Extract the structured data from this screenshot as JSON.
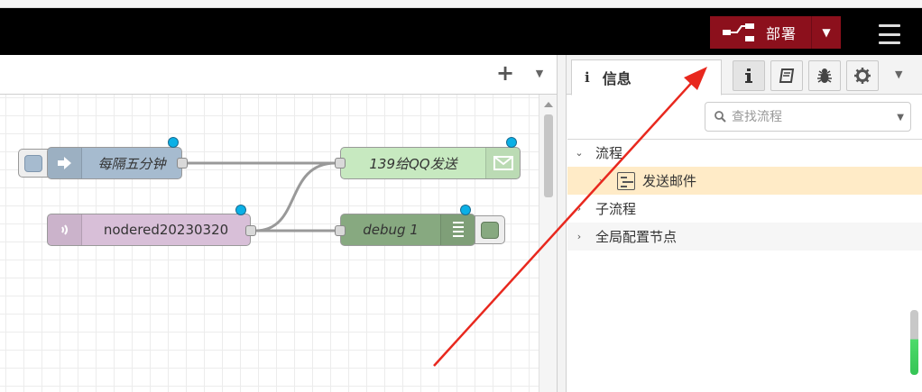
{
  "header": {
    "deploy_label": "部署",
    "deploy_caret": "▼",
    "colors": {
      "header_bg": "#000000",
      "deploy_bg": "#8c101c"
    }
  },
  "workspace": {
    "add_flow": "+",
    "tab_caret": "▼"
  },
  "nodes": {
    "inject": {
      "label": "每隔五分钟",
      "color": "#a6bbcf"
    },
    "mqtt_in": {
      "label": "nodered20230320",
      "color": "#d8bfd8"
    },
    "email_out": {
      "label": "139给QQ发送",
      "color": "#c7e9c0"
    },
    "debug": {
      "label": "debug 1",
      "color": "#87a980"
    }
  },
  "sidebar": {
    "tab_icon": "i",
    "tab_title": "信息",
    "search_placeholder": "查找流程",
    "more_caret": "▼",
    "tree": [
      {
        "label": "流程",
        "chevron": "⌄"
      },
      {
        "label": "发送邮件",
        "chevron": "›"
      },
      {
        "label": "子流程",
        "chevron": "›"
      },
      {
        "label": "全局配置节点",
        "chevron": "›"
      }
    ]
  }
}
